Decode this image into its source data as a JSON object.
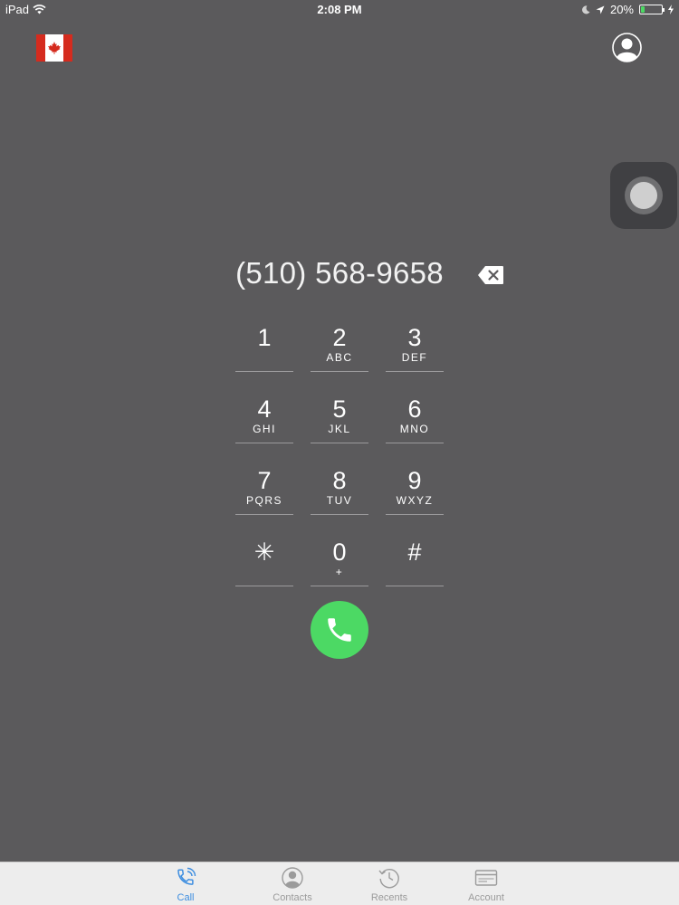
{
  "status_bar": {
    "device": "iPad",
    "time": "2:08 PM",
    "battery_percent": "20%",
    "battery_level": 0.2
  },
  "dialer": {
    "number": "(510) 568-9658",
    "country_flag": "canada-flag",
    "keys": [
      {
        "digit": "1",
        "letters": ""
      },
      {
        "digit": "2",
        "letters": "ABC"
      },
      {
        "digit": "3",
        "letters": "DEF"
      },
      {
        "digit": "4",
        "letters": "GHI"
      },
      {
        "digit": "5",
        "letters": "JKL"
      },
      {
        "digit": "6",
        "letters": "MNO"
      },
      {
        "digit": "7",
        "letters": "PQRS"
      },
      {
        "digit": "8",
        "letters": "TUV"
      },
      {
        "digit": "9",
        "letters": "WXYZ"
      },
      {
        "digit": "✳",
        "letters": ""
      },
      {
        "digit": "0",
        "letters": "+"
      },
      {
        "digit": "#",
        "letters": ""
      }
    ],
    "call_color": "#4cd964"
  },
  "tab_bar": {
    "active_color": "#3e8ee0",
    "tabs": [
      {
        "label": "Call",
        "icon": "phone-call-icon"
      },
      {
        "label": "Contacts",
        "icon": "contact-icon"
      },
      {
        "label": "Recents",
        "icon": "clock-icon"
      },
      {
        "label": "Account",
        "icon": "card-icon"
      }
    ]
  }
}
